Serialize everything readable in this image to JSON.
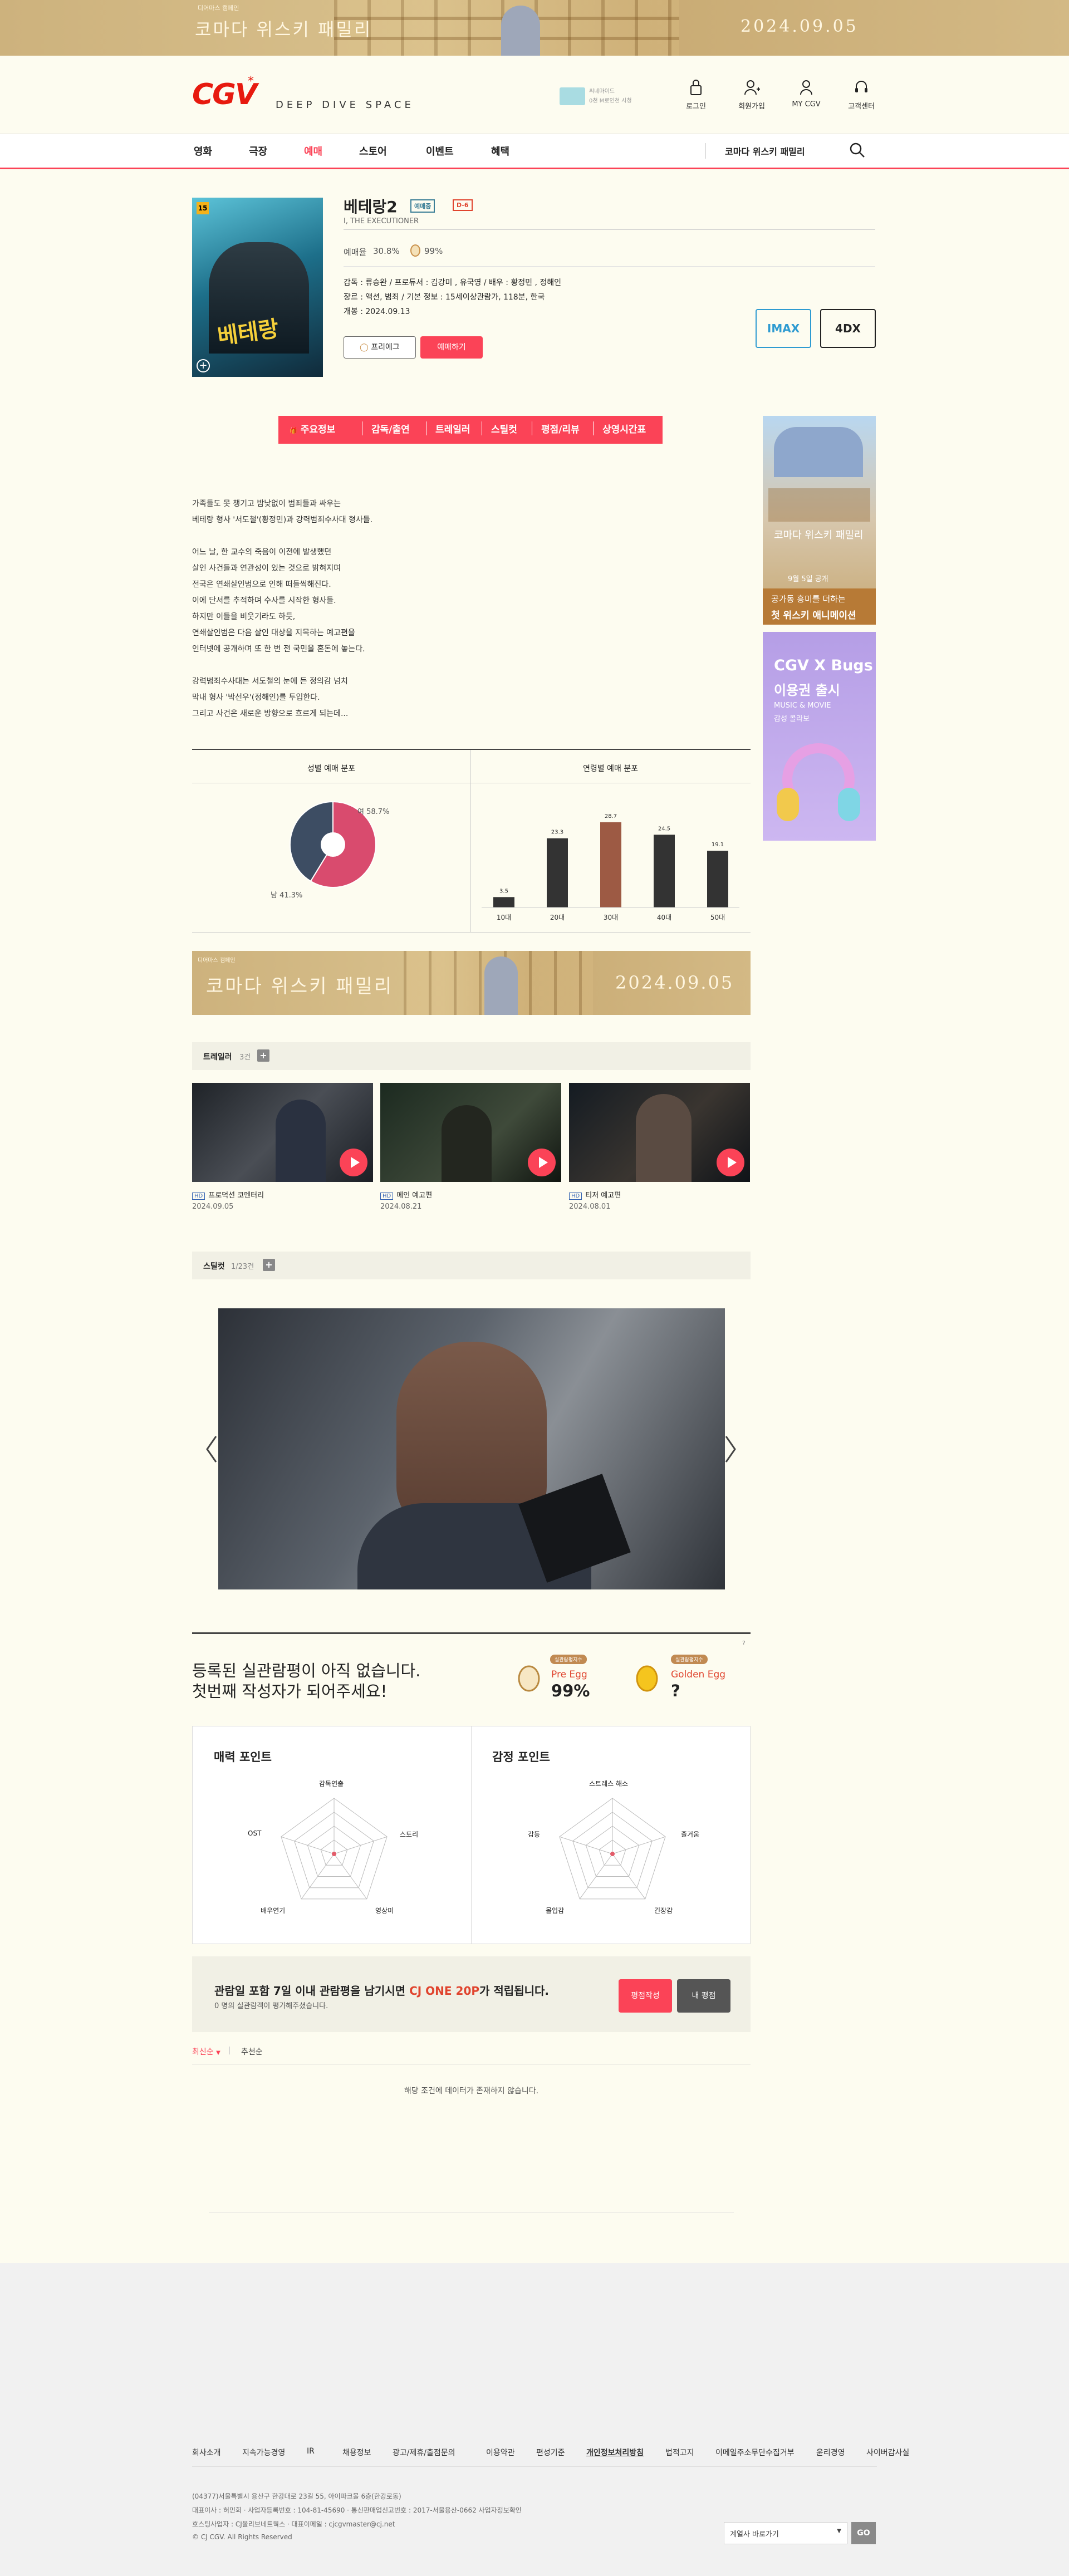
{
  "top_banner": {
    "subtitle": "디어마스 캠페인",
    "title": "코마다 위스키 패밀리",
    "date": "2024.09.05"
  },
  "header": {
    "slogan": "DEEP DIVE SPACE",
    "ad_text_1": "씨네마이드",
    "ad_text_2": "0천 M로인천 시청",
    "links": [
      {
        "label": "로그인",
        "icon": "lock-icon"
      },
      {
        "label": "회원가입",
        "icon": "add-user-icon"
      },
      {
        "label": "MY CGV",
        "icon": "user-icon"
      },
      {
        "label": "고객센터",
        "icon": "headset-icon"
      }
    ]
  },
  "nav": {
    "items": [
      "영화",
      "극장",
      "예매",
      "스토어",
      "이벤트",
      "혜택"
    ],
    "active": "예매",
    "promo": "코마다 위스키 패밀리"
  },
  "movie": {
    "title": "베테랑2",
    "badge_1": "예매중",
    "badge_2": "D-6",
    "english_title": "I, THE EXECUTIONER",
    "rate_label": "예매율",
    "rate_value": "30.8%",
    "egg_value": "99%",
    "credits": "감독 : 류승완 / 프로듀서 : 김강미 , 유국영 / 배우 : 황정민 , 정해인",
    "genre": "장르 : 액션, 범죄 / 기본 정보 : 15세이상관람가, 118분, 한국",
    "release": "개봉 : 2024.09.13",
    "prebook_label": "프리에그",
    "book_label": "예매하기",
    "format_1": "IMAX",
    "format_2": "4DX"
  },
  "tabs": [
    "주요정보",
    "감독/출연",
    "트레일러",
    "스틸컷",
    "평점/리뷰",
    "상영시간표"
  ],
  "synopsis": [
    "가족들도 못 챙기고 밤낮없이 범죄들과 싸우는",
    "베테랑 형사 '서도철'(황정민)과 강력범죄수사대 형사들.",
    "",
    "어느 날, 한 교수의 죽음이 이전에 발생했던",
    "살인 사건들과 연관성이 있는 것으로 밝혀지며",
    "전국은 연쇄살인범으로 인해 떠들썩해진다.",
    "이에 단서를 추적하며 수사를 시작한 형사들.",
    "하지만 이들을 비웃기라도 하듯,",
    "연쇄살인범은 다음 살인 대상을 지목하는 예고편을",
    "인터넷에 공개하며 또 한 번 전 국민을 혼돈에 놓는다.",
    "",
    "강력범죄수사대는 서도철의 눈에 든 정의감 넘치",
    "막내 형사 '박선우'(정해인)를 투입한다.",
    "그리고 사건은 새로운 방향으로 흐르게 되는데..."
  ],
  "gender_chart": {
    "title": "성별 예매 분포",
    "female_label": "여 58.7%",
    "male_label": "남 41.3%"
  },
  "age_chart": {
    "title": "연령별 예매 분포"
  },
  "chart_data": [
    {
      "type": "pie",
      "title": "성별 예매 분포",
      "categories": [
        "여",
        "남"
      ],
      "values": [
        58.7,
        41.3
      ],
      "colors": [
        "#d94b6e",
        "#3d4d63"
      ]
    },
    {
      "type": "bar",
      "title": "연령별 예매 분포",
      "categories": [
        "10대",
        "20대",
        "30대",
        "40대",
        "50대"
      ],
      "values": [
        3.5,
        23.3,
        28.7,
        24.5,
        19.1
      ],
      "colors": [
        "#333333",
        "#333333",
        "#9d5a44",
        "#333333",
        "#333333"
      ],
      "ylim": [
        0,
        30
      ]
    }
  ],
  "mid_banner": {
    "subtitle": "디어마스 캠페인",
    "title": "코마다 위스키 패밀리",
    "date": "2024.09.05"
  },
  "trailer": {
    "label": "트레일러",
    "count": "3건",
    "items": [
      {
        "badge": "HD",
        "title": "프로덕션 코멘터리",
        "date": "2024.09.05"
      },
      {
        "badge": "HD",
        "title": "메인 예고편",
        "date": "2024.08.21"
      },
      {
        "badge": "HD",
        "title": "티저 예고편",
        "date": "2024.08.01"
      }
    ]
  },
  "still": {
    "label": "스틸컷",
    "count": "1/23건"
  },
  "review_header": {
    "line1": "등록된 실관람평이 아직 없습니다.",
    "line2": "첫번째 작성자가 되어주세요!",
    "pre_badge": "실관람평지수",
    "pre_label": "Pre Egg",
    "pre_value": "99%",
    "golden_badge": "실관람평지수",
    "golden_label": "Golden Egg",
    "golden_value": "?"
  },
  "charm": {
    "title": "매력 포인트",
    "axes": [
      "감독연출",
      "스토리",
      "영상미",
      "배우연기",
      "OST"
    ]
  },
  "emotion": {
    "title": "감정 포인트",
    "axes": [
      "스트레스 해소",
      "즐거움",
      "긴장감",
      "몰입감",
      "감동"
    ]
  },
  "point_bar": {
    "text_pre": "관람일 포함 7일 이내 관람평을 남기시면 ",
    "text_highlight": "CJ ONE 20P",
    "text_post": "가 적립됩니다.",
    "sub": "0 명의 실관람객이 평가해주셨습니다.",
    "write_label": "평점작성",
    "my_label": "내 평점"
  },
  "sort": {
    "latest": "최신순",
    "recommend": "추천순",
    "empty": "해당 조건에 데이터가 존재하지 않습니다."
  },
  "ads": {
    "ad1_line1": "코마다 위스키 패밀리",
    "ad1_line2": "9월 5일 공개",
    "ad1_line3": "공가동 흥미를 더하는",
    "ad1_line4": "첫 위스키 애니메이션",
    "ad2_line1": "CGV X Bugs",
    "ad2_line2": "이용권 출시",
    "ad2_line3": "MUSIC & MOVIE",
    "ad2_line4": "감성 콜라보"
  },
  "footer": {
    "links": [
      "회사소개",
      "지속가능경영",
      "IR",
      "채용정보",
      "광고/제휴/출점문의",
      "이용약관",
      "편성기준",
      "개인정보처리방침",
      "법적고지",
      "이메일주소무단수집거부",
      "윤리경영",
      "사이버감사실"
    ],
    "address": "(04377)서울특별시 용산구 한강대로 23길 55, 아이파크몰 6층(한강로동)",
    "ceo": "대표이사 : 허민회  ·  사업자등록번호 : 104-81-45690  ·  통신판매업신고번호 : 2017-서울용산-0662 사업자정보확인",
    "privacy": "호스팅사업자 : CJ올리브네트웍스  ·  대표이메일 : cjcgvmaster@cj.net",
    "copyright": "© CJ CGV. All Rights Reserved",
    "family_site": "계열사 바로가기",
    "go": "GO"
  }
}
